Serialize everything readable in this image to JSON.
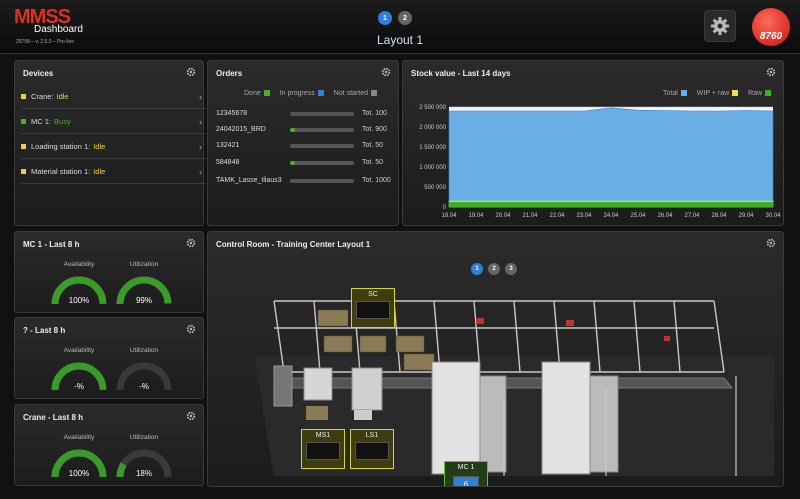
{
  "header": {
    "logo_text": "MMSS",
    "logo_subtitle": "Dashboard",
    "version": "25758 – v. 2.5.0 – Pro line",
    "layout_title": "Layout 1",
    "pages": [
      "1",
      "2"
    ],
    "active_page": "1",
    "brand_text": "8760",
    "settings_icon": "gear-icon"
  },
  "devices": {
    "title": "Devices",
    "items": [
      {
        "name": "Crane:",
        "state": "Idle",
        "color": "#e8d23a"
      },
      {
        "name": "MC 1:",
        "state": "Busy",
        "color": "#4caf2a"
      },
      {
        "name": "Loading station 1:",
        "state": "Idle",
        "color": "#e8d23a"
      },
      {
        "name": "Material station 1:",
        "state": "Idle",
        "color": "#e8d23a"
      }
    ]
  },
  "orders": {
    "title": "Orders",
    "legend": {
      "done": "Done",
      "in_progress": "In progress",
      "not_started": "Not started"
    },
    "legend_colors": {
      "done": "#4caf2a",
      "in_progress": "#3a7fd0",
      "not_started": "#888888"
    },
    "items": [
      {
        "name": "12345678",
        "total": "Tot. 100",
        "progress": 0
      },
      {
        "name": "24042015_BRD",
        "total": "Tot. 900",
        "progress": 0.08
      },
      {
        "name": "132421",
        "total": "Tot. 50",
        "progress": 0
      },
      {
        "name": "584848",
        "total": "Tot. 50",
        "progress": 0.08
      },
      {
        "name": "TAMK_Lasse_tilaus3",
        "total": "Tot. 1000",
        "progress": 0
      }
    ]
  },
  "stock": {
    "title": "Stock value - Last 14 days",
    "legend": {
      "total": "Total",
      "wip": "WIP + raw",
      "raw": "Raw"
    },
    "legend_colors": {
      "total": "#6aaee6",
      "wip": "#e8e23a",
      "raw": "#3cae2a"
    },
    "y_ticks": [
      "2 500 000",
      "2 000 000",
      "1 500 000",
      "1 000 000",
      "500 000",
      "0"
    ],
    "x_ticks": [
      "18.04",
      "19.04",
      "20.04",
      "21.04",
      "22.04",
      "23.04",
      "24.04",
      "25.04",
      "26.04",
      "27.04",
      "28.04",
      "29.04",
      "30.04"
    ]
  },
  "chart_data": {
    "type": "area",
    "title": "Stock value - Last 14 days",
    "x": [
      "18.04",
      "19.04",
      "20.04",
      "21.04",
      "22.04",
      "23.04",
      "24.04",
      "25.04",
      "26.04",
      "27.04",
      "28.04",
      "29.04",
      "30.04"
    ],
    "series": [
      {
        "name": "Total",
        "values": [
          2400000,
          2400000,
          2400000,
          2400000,
          2400000,
          2400000,
          2480000,
          2420000,
          2410000,
          2400000,
          2400000,
          2410000,
          2400000
        ]
      },
      {
        "name": "WIP + raw",
        "values": [
          150000,
          150000,
          150000,
          150000,
          150000,
          150000,
          150000,
          150000,
          150000,
          150000,
          150000,
          150000,
          150000
        ]
      },
      {
        "name": "Raw",
        "values": [
          120000,
          120000,
          120000,
          120000,
          120000,
          120000,
          120000,
          120000,
          120000,
          120000,
          120000,
          120000,
          120000
        ]
      }
    ],
    "ylim": [
      0,
      2500000
    ],
    "legend": "top-right",
    "grid": true
  },
  "gauges": [
    {
      "title": "MC 1 - Last 8 h",
      "availability_label": "Availability",
      "utilization_label": "Utilization",
      "availability": "100%",
      "utilization": "99%",
      "availability_frac": 1.0,
      "utilization_frac": 0.99
    },
    {
      "title": "? - Last 8 h",
      "availability_label": "Availability",
      "utilization_label": "Utilization",
      "availability": "-%",
      "utilization": "-%",
      "availability_frac": 1.0,
      "utilization_frac": 0
    },
    {
      "title": "Crane - Last 8 h",
      "availability_label": "Availability",
      "utilization_label": "Utilization",
      "availability": "100%",
      "utilization": "18%",
      "availability_frac": 1.0,
      "utilization_frac": 0.18
    }
  ],
  "control_room": {
    "title": "Control Room - Training Center Layout 1",
    "pages": [
      "1",
      "2",
      "3"
    ],
    "active_page": "1",
    "tags": [
      {
        "label": "SC"
      },
      {
        "label": "MS1"
      },
      {
        "label": "LS1"
      },
      {
        "label": "MC 1",
        "value": "6"
      }
    ]
  }
}
